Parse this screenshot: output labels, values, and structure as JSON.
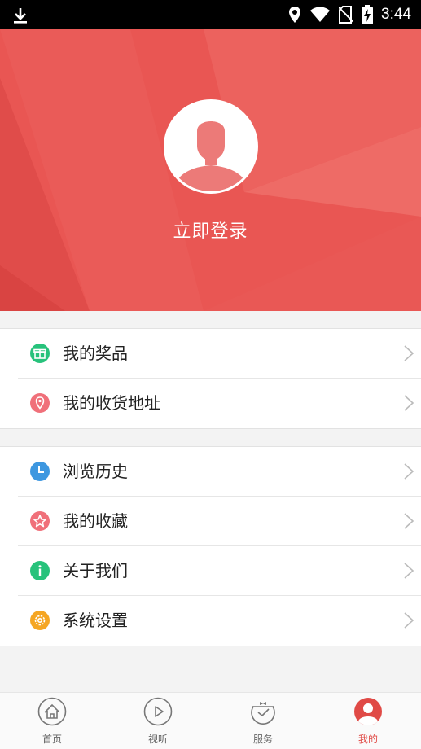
{
  "status_bar": {
    "time": "3:44"
  },
  "header": {
    "login_label": "立即登录"
  },
  "menu_group_1": [
    {
      "label": "我的奖品",
      "icon": "gift-icon",
      "color": "#27c27b"
    },
    {
      "label": "我的收货地址",
      "icon": "location-pin-icon",
      "color": "#f0707a"
    }
  ],
  "menu_group_2": [
    {
      "label": "浏览历史",
      "icon": "clock-icon",
      "color": "#3d97e0"
    },
    {
      "label": "我的收藏",
      "icon": "star-icon",
      "color": "#f0707a"
    },
    {
      "label": "关于我们",
      "icon": "info-icon",
      "color": "#27c27b"
    },
    {
      "label": "系统设置",
      "icon": "gear-icon",
      "color": "#f5a623"
    }
  ],
  "tabs": [
    {
      "label": "首页",
      "icon": "home-icon"
    },
    {
      "label": "视听",
      "icon": "play-icon"
    },
    {
      "label": "服务",
      "icon": "service-icon"
    },
    {
      "label": "我的",
      "icon": "profile-icon",
      "active": true
    }
  ],
  "colors": {
    "accent": "#e95653",
    "active_tab": "#e04a46"
  }
}
